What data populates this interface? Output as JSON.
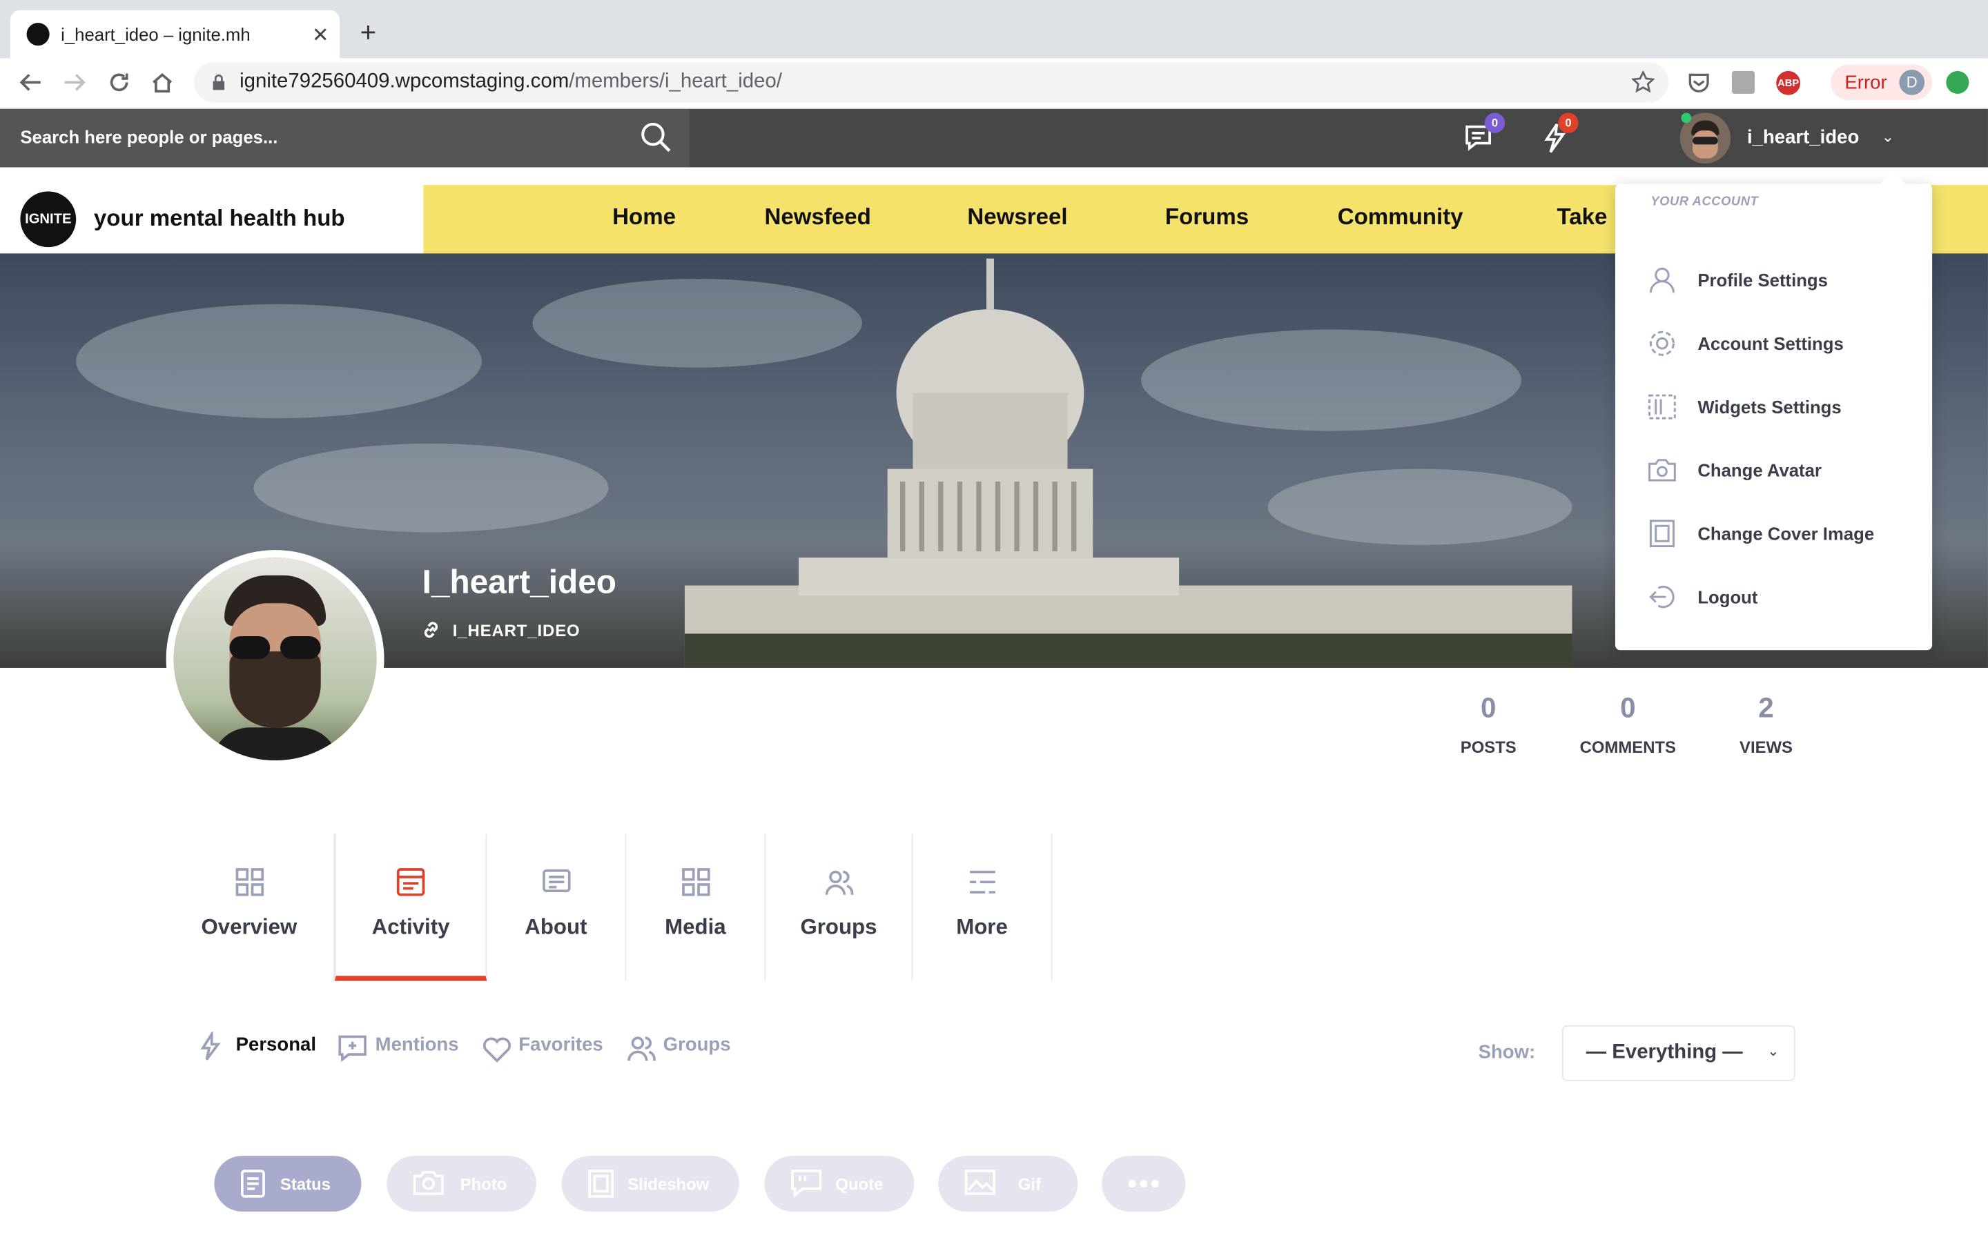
{
  "browser": {
    "tab_title": "i_heart_ideo – ignite.mh",
    "tab_close": "✕",
    "new_tab": "+",
    "url_host": "ignite792560409.wpcomstaging.com",
    "url_path": "/members/i_heart_ideo/",
    "error_label": "Error",
    "profile_initial": "D"
  },
  "site": {
    "search_placeholder": "Search here people or pages...",
    "messages_count": "0",
    "notifications_count": "0",
    "username": "i_heart_ideo",
    "logo_text": "IGNITE",
    "tagline": "your mental health hub",
    "nav": [
      "Home",
      "Newsfeed",
      "Newsreel",
      "Forums",
      "Community",
      "Take"
    ]
  },
  "profile": {
    "name": "I_heart_ideo",
    "handle": "I_HEART_IDEO",
    "stats": [
      {
        "value": "0",
        "label": "POSTS"
      },
      {
        "value": "0",
        "label": "COMMENTS"
      },
      {
        "value": "2",
        "label": "VIEWS"
      }
    ],
    "tabs": [
      {
        "label": "Overview",
        "icon": "grid-icon"
      },
      {
        "label": "Activity",
        "icon": "activity-icon"
      },
      {
        "label": "About",
        "icon": "about-icon"
      },
      {
        "label": "Media",
        "icon": "media-icon"
      },
      {
        "label": "Groups",
        "icon": "groups-icon"
      },
      {
        "label": "More",
        "icon": "more-icon"
      }
    ]
  },
  "account_menu": {
    "heading": "YOUR ACCOUNT",
    "items": [
      "Profile Settings",
      "Account Settings",
      "Widgets Settings",
      "Change Avatar",
      "Change Cover Image",
      "Logout"
    ]
  },
  "activity": {
    "filters": [
      "Personal",
      "Mentions",
      "Favorites",
      "Groups"
    ],
    "show_label": "Show:",
    "show_value": "— Everything —",
    "post_types": [
      "Status",
      "Photo",
      "Slideshow",
      "Quote",
      "Gif"
    ]
  },
  "colors": {
    "nav_yellow": "#f5e26b",
    "accent_red": "#e0412b",
    "badge_purple": "#7b5cd6",
    "badge_red": "#e0412b"
  }
}
